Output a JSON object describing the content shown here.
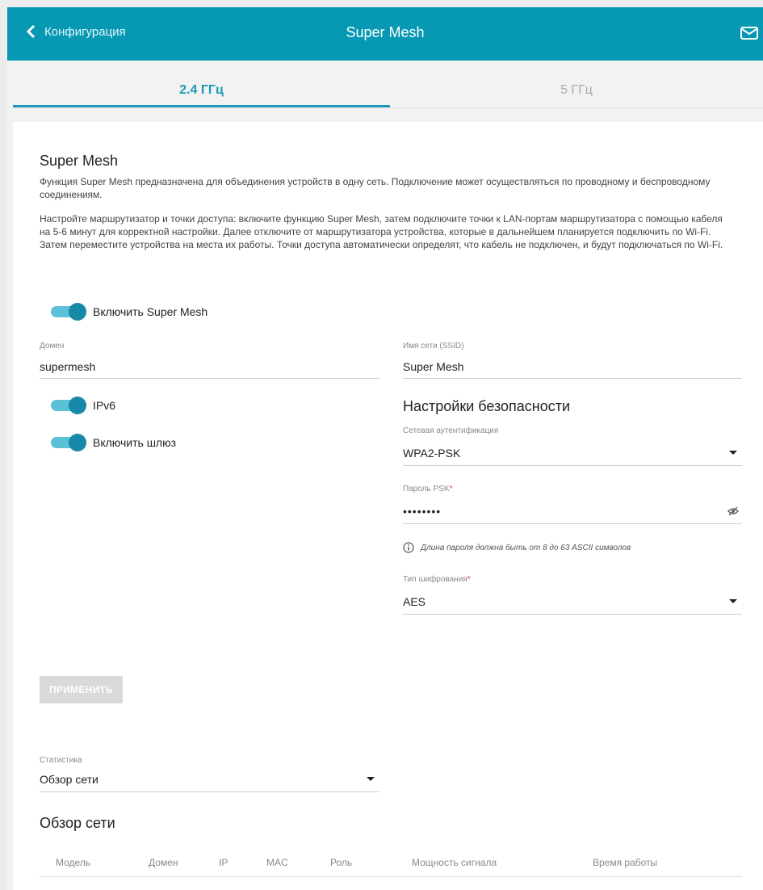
{
  "header": {
    "back_label": "Конфигурация",
    "title": "Super Mesh"
  },
  "tabs": [
    {
      "label": "2.4 ГГц",
      "active": true
    },
    {
      "label": "5 ГГц",
      "active": false
    }
  ],
  "main": {
    "section_title": "Super Mesh",
    "desc1": "Функция Super Mesh предназначена для объединения устройств в одну сеть. Подключение может осуществляться по проводному и беспроводному соединениям.",
    "desc2": "Настройте маршрутизатор и точки доступа: включите функцию Super Mesh, затем подключите точки к LAN-портам маршрутизатора с помощью кабеля на 5-6 минут для корректной настройки. Далее отключите от маршрутизатора устройства, которые в дальнейшем планируется подключить по Wi-Fi. Затем переместите устройства на места их работы. Точки доступа автоматически определят, что кабель не подключен, и будут подключаться по Wi-Fi.",
    "toggle_supermesh": {
      "label": "Включить Super Mesh",
      "on": true
    },
    "domain": {
      "label": "Домен",
      "value": "supermesh"
    },
    "ssid": {
      "label": "Имя сети (SSID)",
      "value": "Super Mesh"
    },
    "toggle_ipv6": {
      "label": "IPv6",
      "on": true
    },
    "toggle_gateway": {
      "label": "Включить шлюз",
      "on": true
    },
    "security_title": "Настройки безопасности",
    "auth": {
      "label": "Сетевая аутентификация",
      "value": "WPA2-PSK"
    },
    "psk": {
      "label": "Пароль PSK",
      "required_mark": "*",
      "value": "••••••••"
    },
    "hint": "Длина пароля должна быть от 8 до 63 ASCII символов",
    "cipher": {
      "label": "Тип шифрования",
      "required_mark": "*",
      "value": "AES"
    },
    "apply_label": "ПРИМЕНИТЬ",
    "stats": {
      "label": "Статистика",
      "value": "Обзор сети"
    },
    "overview_title": "Обзор сети",
    "table_headers": [
      "Модель",
      "Домен",
      "IP",
      "MAC",
      "Роль",
      "Мощность сигнала",
      "Время работы"
    ]
  },
  "colors": {
    "header": "#0798b4",
    "accent": "#1d9ab8",
    "required": "#e53935"
  },
  "icons": {
    "back": "chevron-left-icon",
    "mail": "mail-icon",
    "eye": "eye-off-icon",
    "info": "info-icon",
    "dropdown": "caret-down-icon"
  }
}
